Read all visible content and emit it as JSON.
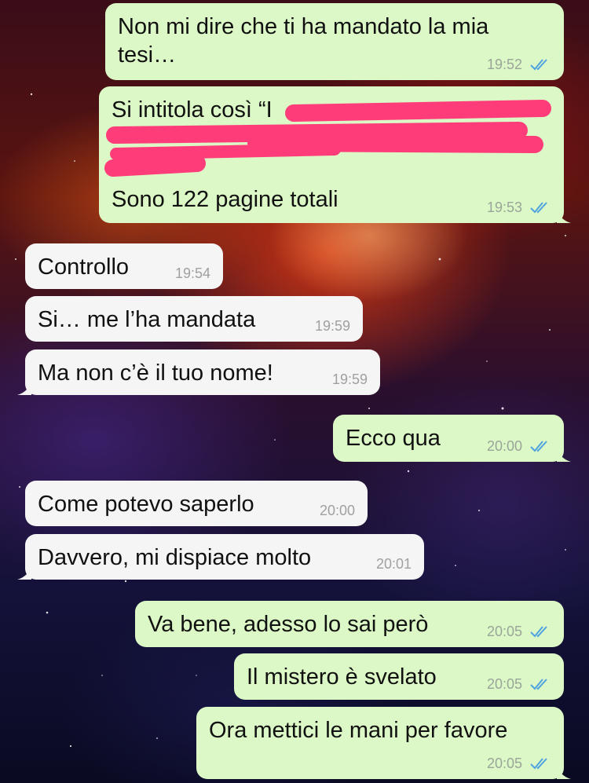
{
  "chat": {
    "theme": {
      "outgoing_bubble": "#dcf8c6",
      "incoming_bubble": "#f5f5f5",
      "read_ticks": "#4fa3e0",
      "redaction": "#ff3c7a"
    },
    "messages": [
      {
        "direction": "outgoing",
        "text": "Non mi dire che ti ha mandato la mia tesi…",
        "time": "19:52",
        "ticks": "double-check-read-icon"
      },
      {
        "direction": "outgoing",
        "text_visible_start": "Si intitola così “I",
        "text_visible_end": "Sono 122 pagine totali",
        "redacted": true,
        "time": "19:53",
        "ticks": "double-check-read-icon"
      },
      {
        "direction": "incoming",
        "text": "Controllo",
        "time": "19:54"
      },
      {
        "direction": "incoming",
        "text": "Si… me l’ha mandata",
        "time": "19:59"
      },
      {
        "direction": "incoming",
        "text": "Ma non c’è il tuo nome!",
        "time": "19:59"
      },
      {
        "direction": "outgoing",
        "text": "Ecco qua",
        "time": "20:00",
        "ticks": "double-check-read-icon"
      },
      {
        "direction": "incoming",
        "text": "Come potevo saperlo",
        "time": "20:00"
      },
      {
        "direction": "incoming",
        "text": "Davvero, mi dispiace molto",
        "time": "20:01"
      },
      {
        "direction": "outgoing",
        "text": "Va bene, adesso lo sai però",
        "time": "20:05",
        "ticks": "double-check-read-icon"
      },
      {
        "direction": "outgoing",
        "text": "Il mistero è svelato",
        "time": "20:05",
        "ticks": "double-check-read-icon"
      },
      {
        "direction": "outgoing",
        "text": "Ora mettici le mani per favore",
        "time": "20:05",
        "ticks": "double-check-read-icon"
      }
    ]
  }
}
